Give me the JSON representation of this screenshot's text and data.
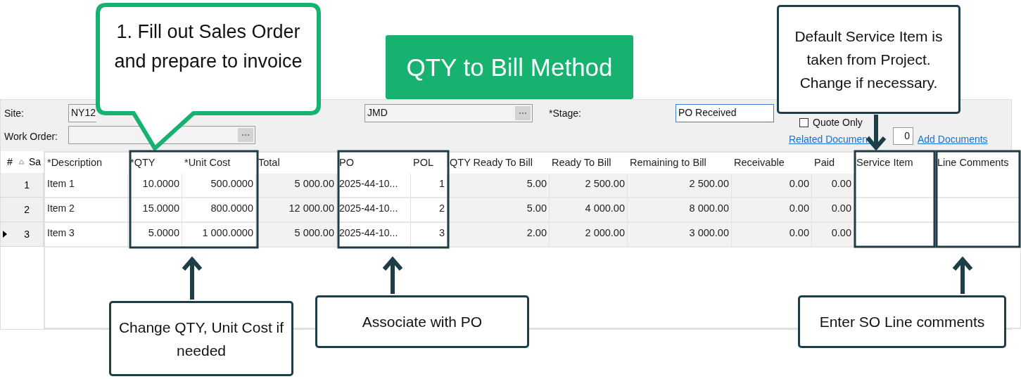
{
  "title_badge": "QTY to Bill Method",
  "form": {
    "site": {
      "label": "Site:",
      "value": "NY12"
    },
    "customer": {
      "value": "JMD"
    },
    "stage": {
      "label": "*Stage:",
      "value": "PO Received"
    },
    "quote_only": {
      "label": "Quote Only",
      "checked": false
    },
    "work_order": {
      "label": "Work Order:"
    },
    "related_documents": "Related Document",
    "document_count": "0",
    "add_documents": "Add Documents"
  },
  "row_header": {
    "columns": [
      "#",
      "Sa"
    ],
    "rows": [
      {
        "number": "1",
        "current": false
      },
      {
        "number": "2",
        "current": false
      },
      {
        "number": "3",
        "current": true
      }
    ]
  },
  "grid": {
    "columns": [
      {
        "title": "*Description",
        "readonly": false
      },
      {
        "title": "*QTY",
        "readonly": false
      },
      {
        "title": "*Unit Cost",
        "readonly": false
      },
      {
        "title": "Total",
        "readonly": true
      },
      {
        "title": "PO",
        "readonly": false
      },
      {
        "title": "POL",
        "readonly": false
      },
      {
        "title": "QTY Ready To Bill",
        "readonly": true
      },
      {
        "title": "Ready To Bill",
        "readonly": true
      },
      {
        "title": "Remaining to Bill",
        "readonly": true
      },
      {
        "title": "Receivable",
        "readonly": true
      },
      {
        "title": "Paid",
        "readonly": true
      },
      {
        "title": "Service Item",
        "readonly": false
      },
      {
        "title": "Line Comments",
        "readonly": false
      }
    ],
    "rows": [
      [
        "Item 1",
        "10.0000",
        "500.0000",
        "5 000.00",
        "2025-44-10...",
        "1",
        "5.00",
        "2 500.00",
        "2 500.00",
        "0.00",
        "0.00"
      ],
      [
        "Item 2",
        "15.0000",
        "800.0000",
        "12 000.00",
        "2025-44-10...",
        "2",
        "5.00",
        "4 000.00",
        "8 000.00",
        "0.00",
        "0.00"
      ],
      [
        "Item 3",
        "5.0000",
        "1 000.0000",
        "5 000.00",
        "2025-44-10...",
        "3",
        "2.00",
        "2 000.00",
        "3 000.00",
        "0.00",
        "0.00"
      ]
    ]
  },
  "callouts": [
    {
      "kind": "speech",
      "text": "1. Fill out Sales Order and prepare to invoice"
    },
    {
      "kind": "box",
      "text": "Default Service Item is taken from Project. Change if necessary."
    },
    {
      "kind": "box",
      "text": "Change QTY, Unit Cost if needed"
    },
    {
      "kind": "box",
      "text": "Associate with PO"
    },
    {
      "kind": "box",
      "text": "Enter SO Line comments"
    }
  ]
}
